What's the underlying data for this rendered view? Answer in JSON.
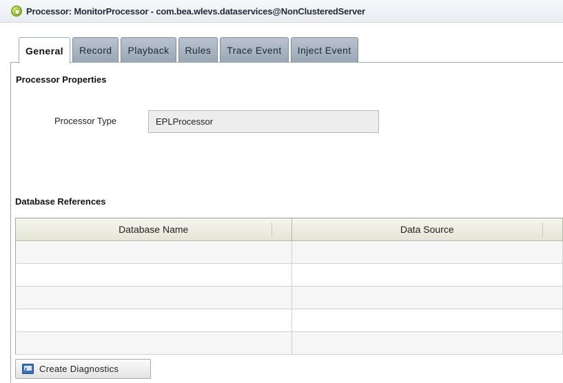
{
  "window": {
    "title": "Processor: MonitorProcessor - com.bea.wlevs.dataservices@NonClusteredServer",
    "icon": "processor-gear-icon"
  },
  "tabs": [
    {
      "label": "General",
      "active": true
    },
    {
      "label": "Record",
      "active": false
    },
    {
      "label": "Playback",
      "active": false
    },
    {
      "label": "Rules",
      "active": false
    },
    {
      "label": "Trace Event",
      "active": false
    },
    {
      "label": "Inject Event",
      "active": false
    }
  ],
  "processor_properties": {
    "heading": "Processor Properties",
    "type_label": "Processor Type",
    "type_value": "EPLProcessor"
  },
  "database_references": {
    "heading": "Database References",
    "columns": [
      "Database Name",
      "Data Source"
    ],
    "rows": [
      [
        "",
        ""
      ],
      [
        "",
        ""
      ],
      [
        "",
        ""
      ],
      [
        "",
        ""
      ],
      [
        "",
        ""
      ]
    ]
  },
  "actions": {
    "create_diagnostics_label": "Create Diagnostics",
    "create_diagnostics_icon": "diagnostics-chart-icon"
  }
}
